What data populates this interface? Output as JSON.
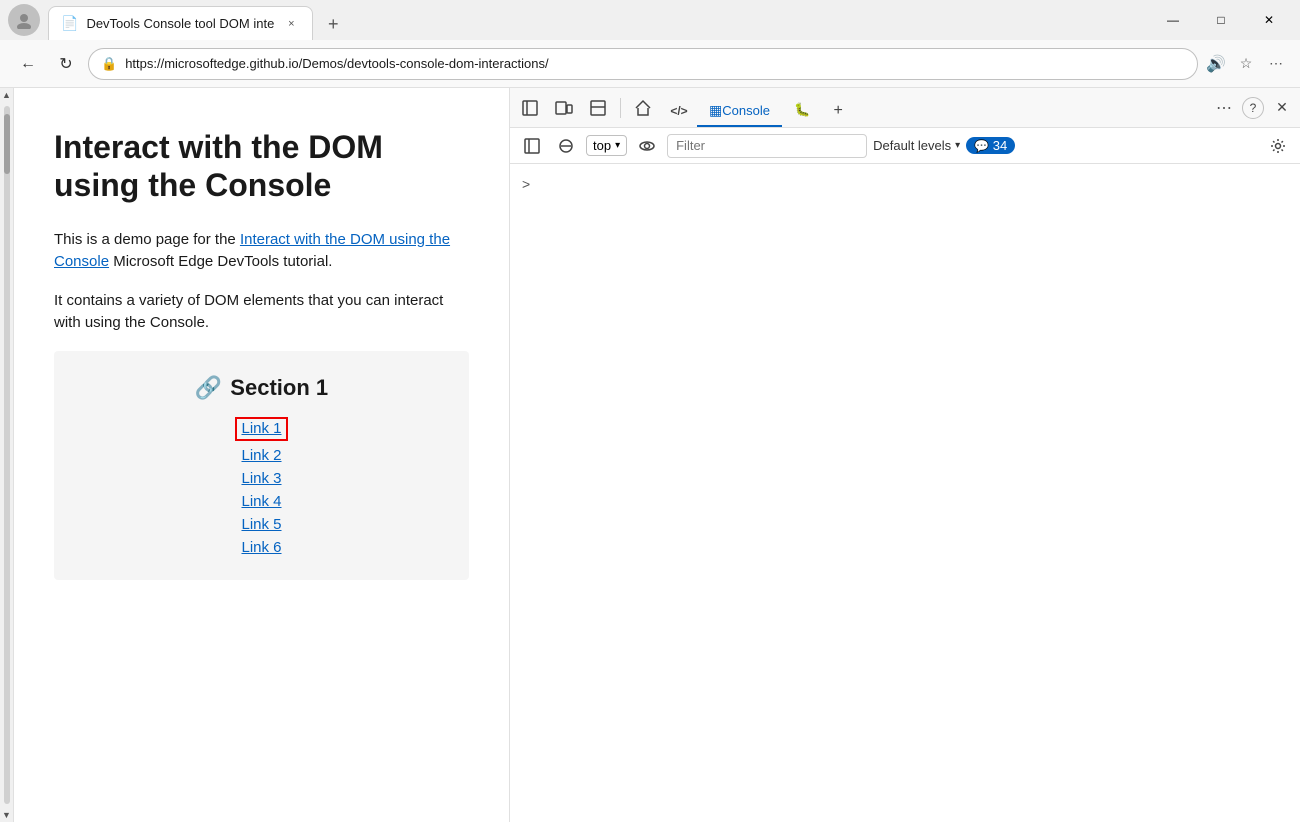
{
  "window": {
    "title": "DevTools Console tool DOM inte",
    "tab_icon": "📄",
    "close_label": "×"
  },
  "browser": {
    "back_disabled": false,
    "forward_disabled": true,
    "url": "https://microsoftedge.github.io/Demos/devtools-console-dom-interactions/",
    "new_tab_label": "+",
    "minimize_label": "—",
    "maximize_label": "□",
    "close_label": "✕"
  },
  "webpage": {
    "heading": "Interact with the DOM using the Console",
    "para1_prefix": "This is a demo page for the ",
    "para1_link": "Interact with the DOM using the Console",
    "para1_suffix": " Microsoft Edge DevTools tutorial.",
    "para2": "It contains a variety of DOM elements that you can interact with using the Console.",
    "section1_title": "Section 1",
    "section1_icon": "🔗",
    "links": [
      "Link 1",
      "Link 2",
      "Link 3",
      "Link 4",
      "Link 5",
      "Link 6"
    ]
  },
  "devtools": {
    "tools": [
      {
        "name": "inspect-element-icon",
        "symbol": "⬚",
        "tooltip": "Inspect element"
      },
      {
        "name": "device-emulation-icon",
        "symbol": "⧉",
        "tooltip": "Device emulation"
      },
      {
        "name": "toggle-sidebar-icon",
        "symbol": "▭",
        "tooltip": "Toggle sidebar"
      },
      {
        "name": "home-icon",
        "symbol": "⌂",
        "tooltip": "Home"
      },
      {
        "name": "source-code-icon",
        "symbol": "</>",
        "tooltip": "Source"
      }
    ],
    "tabs": [
      {
        "label": "Console",
        "active": true
      },
      {
        "label": "🐞",
        "active": false
      }
    ],
    "console_tab_label": "Console",
    "add_tab_label": "+",
    "more_label": "⋯",
    "help_label": "?",
    "close_label": "✕"
  },
  "console": {
    "sidebar_label": "Show console sidebar",
    "clear_label": "Clear console",
    "top_label": "top",
    "eye_label": "👁",
    "filter_placeholder": "Filter",
    "default_levels_label": "Default levels",
    "message_count": "34",
    "settings_label": "Console settings",
    "prompt_chevron": ">"
  }
}
